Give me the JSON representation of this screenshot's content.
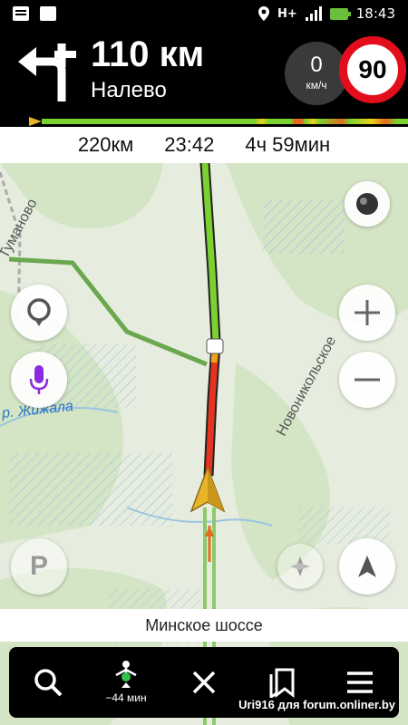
{
  "status_bar": {
    "time": "18:43",
    "network": "H+"
  },
  "maneuver": {
    "distance": "110 км",
    "direction": "Налево",
    "icon": "turn-left-icon"
  },
  "speed": {
    "value": "0",
    "unit": "км/ч"
  },
  "speed_limit": "90",
  "route": {
    "distance": "220км",
    "arrival": "23:42",
    "duration": "4ч 59мин"
  },
  "map": {
    "labels": {
      "village": "Туманово",
      "river": "р. Жижала",
      "village2": "Новоникольское"
    },
    "parking_letter": "P"
  },
  "current_street": "Минское шоссе",
  "bottom_nav": {
    "search_icon": "search-icon",
    "alternatives_label": "−44 мин",
    "close_icon": "close-icon",
    "bookmarks_icon": "bookmarks-icon",
    "menu_icon": "menu-icon"
  },
  "watermark": "Uri916 для forum.onliner.by",
  "colors": {
    "route_green": "#7bd12f",
    "route_red": "#e6331f",
    "limit_red": "#e30e1c",
    "voice_purple": "#8a2be2"
  }
}
